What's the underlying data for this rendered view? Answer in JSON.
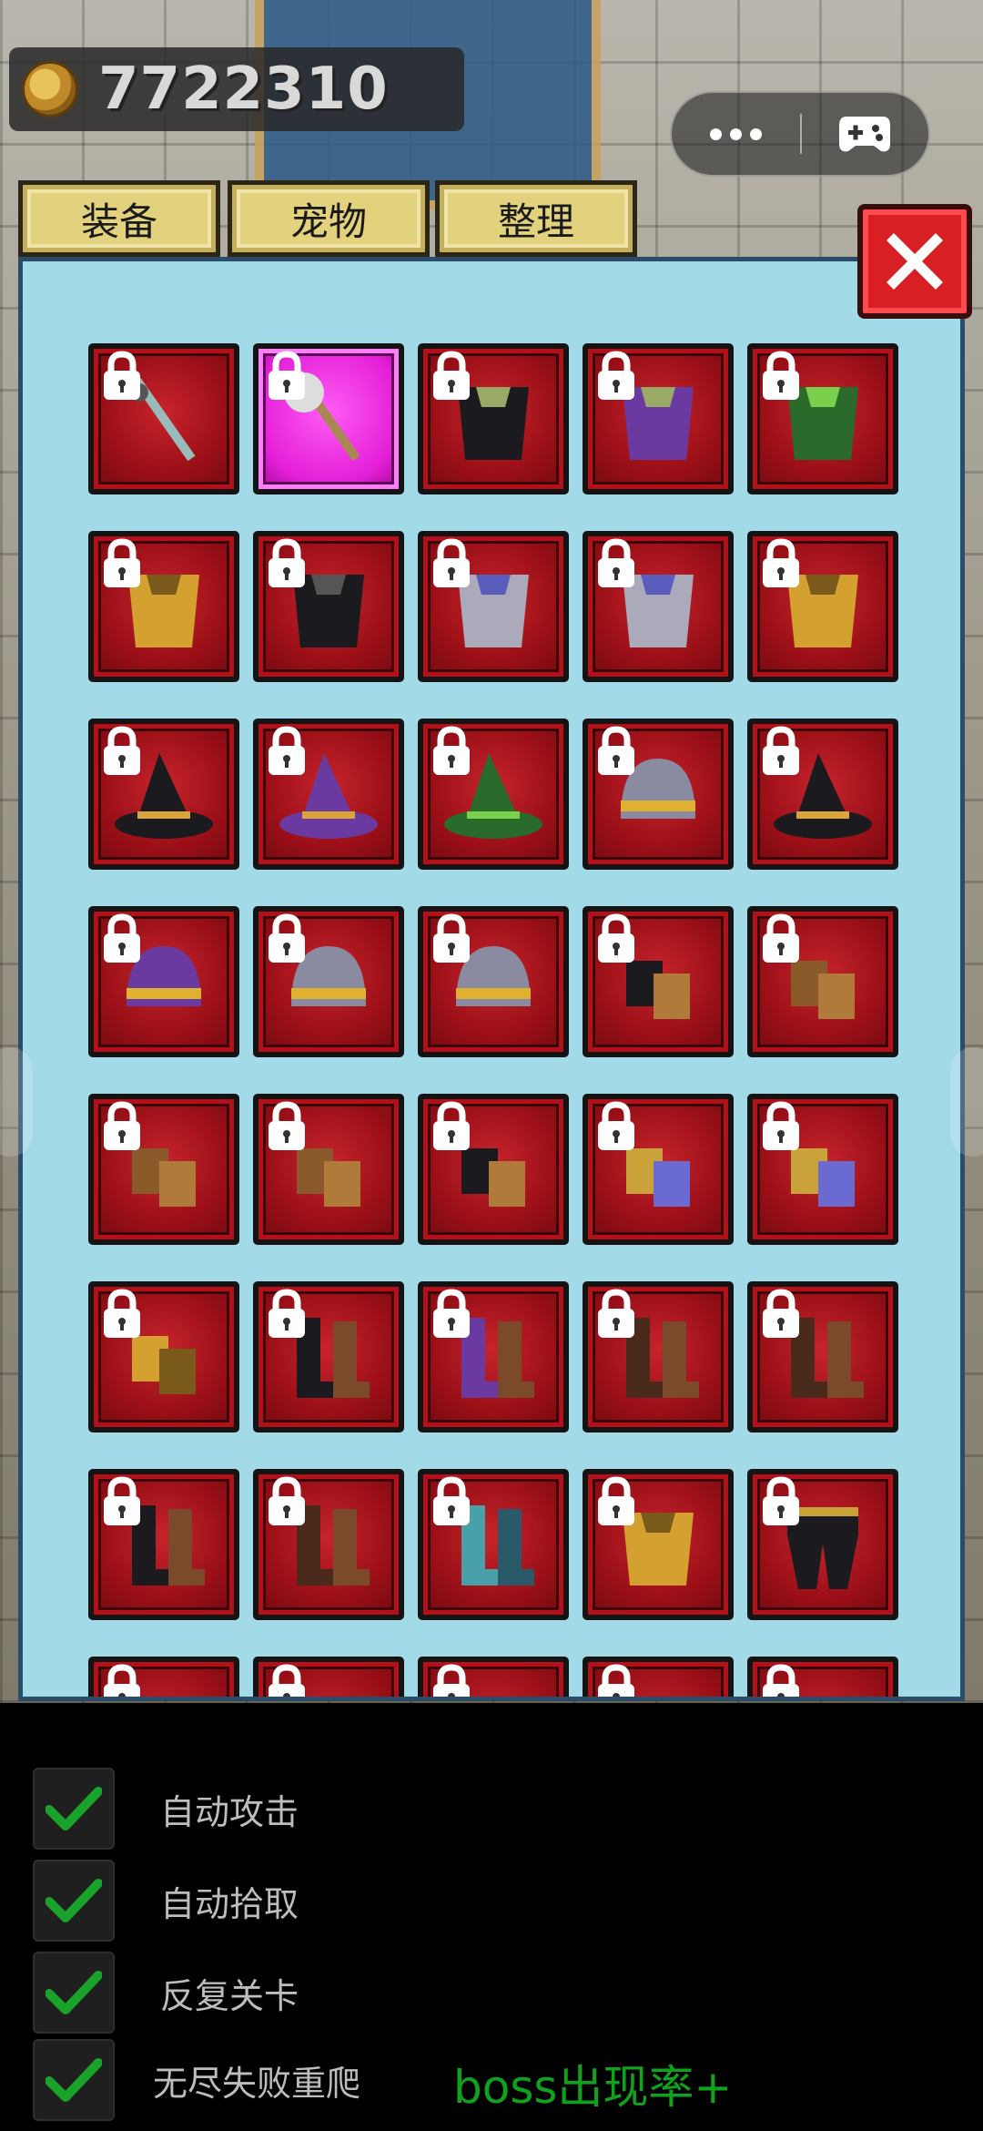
{
  "coins": {
    "value": "7722310"
  },
  "capsule": {
    "more_icon": "more-dots-icon",
    "game_icon": "gamepad-icon"
  },
  "tabs": [
    {
      "label": "装备"
    },
    {
      "label": "宠物"
    },
    {
      "label": "整理"
    }
  ],
  "close": {
    "icon": "close-x-icon"
  },
  "inventory": {
    "rows": [
      [
        "spear-icon",
        "mace-icon",
        "dark-cape-icon",
        "purple-cape-icon",
        "green-cape-icon"
      ],
      [
        "gold-robe-icon",
        "black-hood-icon",
        "steel-armor-icon",
        "knight-armor-icon",
        "gold-armor-icon"
      ],
      [
        "black-wizard-hat-icon",
        "purple-wizard-hat-icon",
        "green-hat-icon",
        "feather-helmet-icon",
        "black-hat-icon"
      ],
      [
        "purple-helmet-icon",
        "iron-helmet-icon",
        "horned-helmet-icon",
        "black-gloves-icon",
        "brown-gloves-icon"
      ],
      [
        "leather-gloves-icon",
        "claw-gloves-icon",
        "dark-gloves-icon",
        "ornate-gauntlet-icon",
        "steel-gauntlet-icon"
      ],
      [
        "gold-gauntlet-icon",
        "dark-boots-icon",
        "purple-boots-icon",
        "brown-boots-icon",
        "winged-boots-icon"
      ],
      [
        "black-boots-icon",
        "plate-boots-icon",
        "teal-boots-icon",
        "gold-greaves-icon",
        "dark-pants-icon"
      ],
      [
        "item-icon",
        "item-icon",
        "item-icon",
        "item-icon",
        "item-icon"
      ]
    ],
    "selected": [
      0,
      1
    ]
  },
  "settings": [
    {
      "label": "自动攻击",
      "checked": true
    },
    {
      "label": "自动拾取",
      "checked": true
    },
    {
      "label": "反复关卡",
      "checked": true
    },
    {
      "label": "无尽失败重爬",
      "checked": true
    }
  ],
  "boss_rate": "boss出现率+",
  "colors": {
    "slot_red": "#b3101a",
    "panel_blue": "#a3dae8",
    "tab_gold": "#e3d27d",
    "check_green": "#1aa32a",
    "selected_magenta": "#e31ed7"
  }
}
